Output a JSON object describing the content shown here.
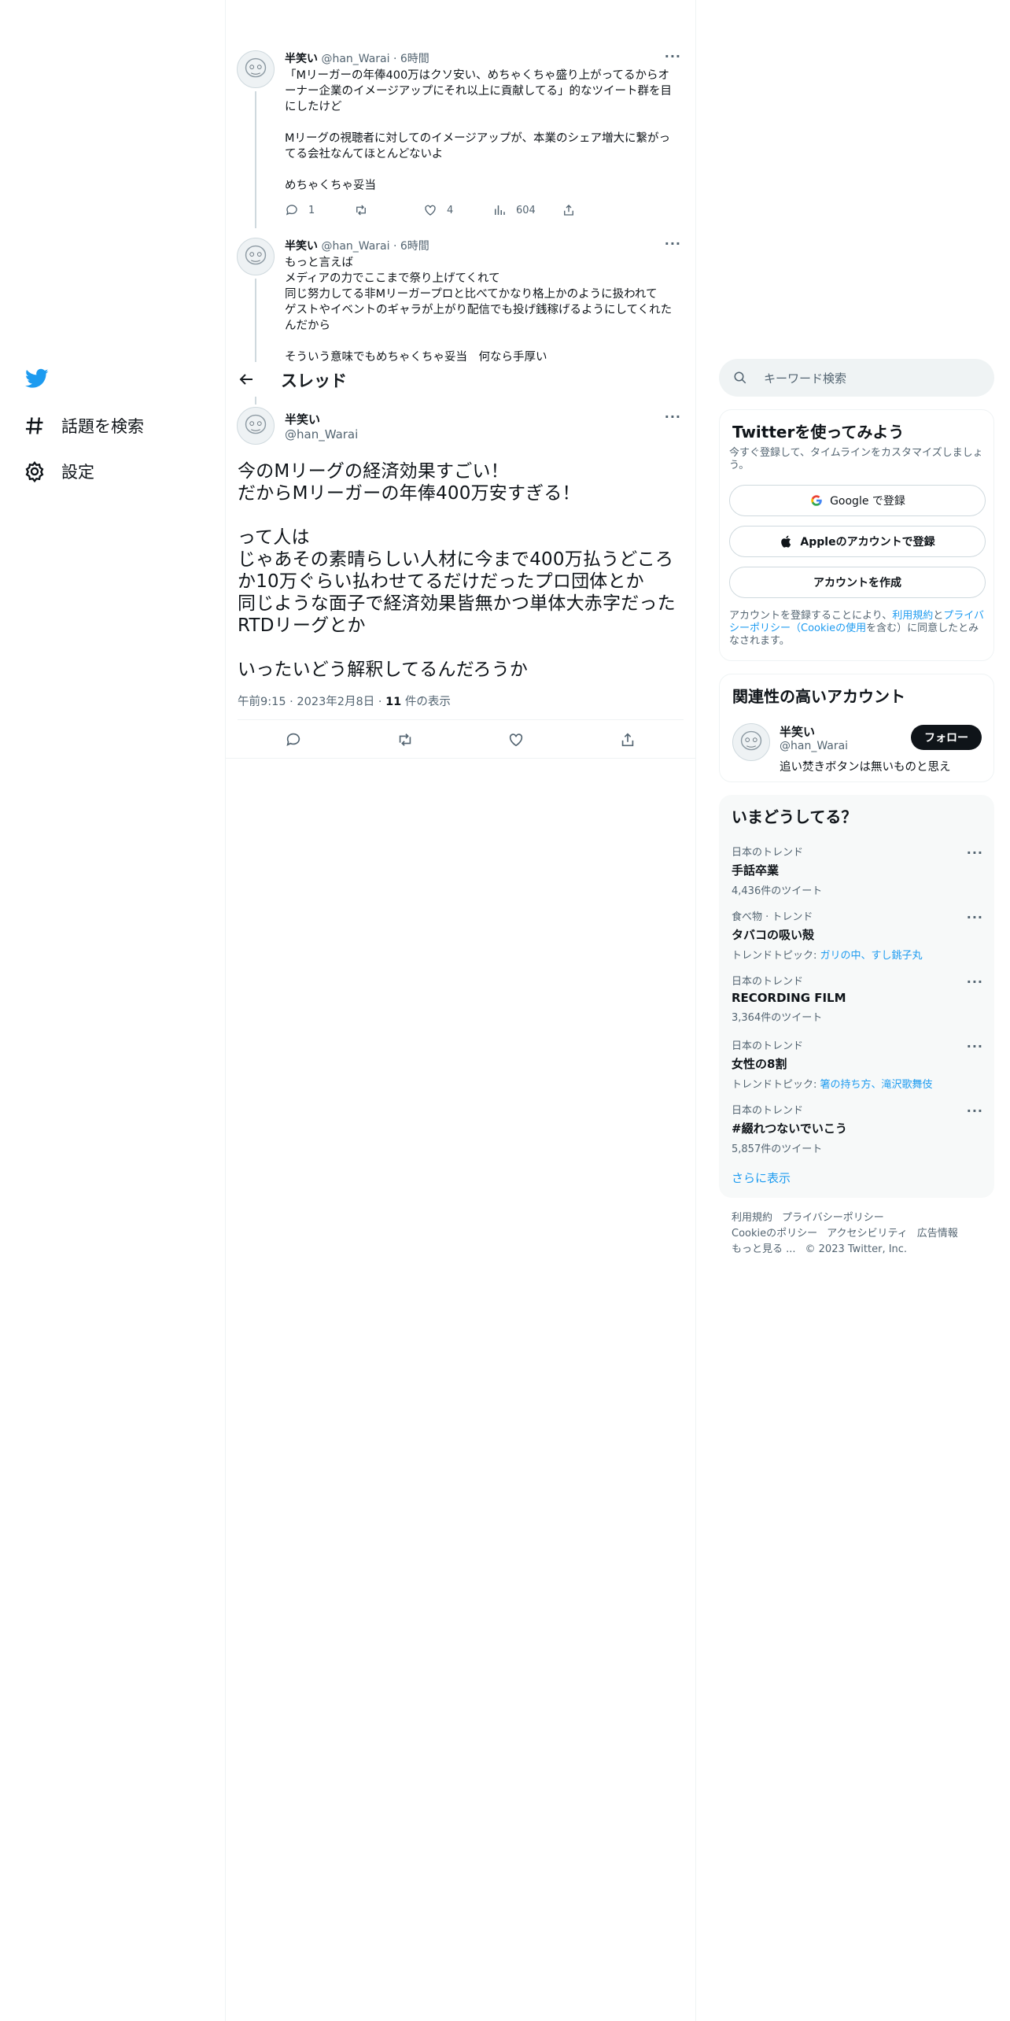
{
  "nav": {
    "explore_label": "話題を検索",
    "settings_label": "設定"
  },
  "thread": {
    "header_title": "スレッド",
    "prev_tweets": [
      {
        "name": "半笑い",
        "handle": "@han_Warai",
        "time": "6時間",
        "text": "「Mリーガーの年俸400万はクソ安い、めちゃくちゃ盛り上がってるからオーナー企業のイメージアップにそれ以上に貢献してる」的なツイート群を目にしたけど\n\nMリーグの視聴者に対してのイメージアップが、本業のシェア増大に繋がってる会社なんてほとんどないよ\n\nめちゃくちゃ妥当",
        "replies": "1",
        "retweets": "",
        "likes": "4",
        "views": "604"
      },
      {
        "name": "半笑い",
        "handle": "@han_Warai",
        "time": "6時間",
        "text": "もっと言えば\nメディアの力でここまで祭り上げてくれて\n同じ努力してる非Mリーガープロと比べてかなり格上かのように扱われて\nゲストやイベントのギャラが上がり配信でも投げ銭稼げるようにしてくれたんだから\n\nそういう意味でもめちゃくちゃ妥当　何なら手厚い"
      }
    ],
    "focal": {
      "name": "半笑い",
      "handle": "@han_Warai",
      "text": "今のMリーグの経済効果すごい！\nだからMリーガーの年俸400万安すぎる！\n\nって人は\nじゃあその素晴らしい人材に今まで400万払うどころか10万ぐらい払わせてるだけだったプロ団体とか\n同じような面子で経済効果皆無かつ単体大赤字だったRTDリーグとか\n\nいったいどう解釈してるんだろうか",
      "time": "午前9:15",
      "date": "2023年2月8日",
      "views_count": "11",
      "views_label": "件の表示"
    }
  },
  "search": {
    "placeholder": "キーワード検索"
  },
  "signup": {
    "title": "Twitterを使ってみよう",
    "desc": "今すぐ登録して、タイムラインをカスタマイズしましょう。",
    "google_label": "Google で登録",
    "apple_label": "Appleのアカウントで登録",
    "create_label": "アカウントを作成",
    "legal_pre": "アカウントを登録することにより、",
    "legal_terms": "利用規約",
    "legal_and": "と",
    "legal_privacy": "プライバシーポリシー",
    "legal_cookie": "（Cookieの使用",
    "legal_post": "を含む）に同意したとみなされます。"
  },
  "related": {
    "title": "関連性の高いアカウント",
    "name": "半笑い",
    "handle": "@han_Warai",
    "bio": "追い焚きボタンは無いものと思え",
    "follow_label": "フォロー"
  },
  "trends": {
    "title": "いまどうしてる？",
    "items": [
      {
        "category": "日本のトレンド",
        "name": "手話卒業",
        "sub_label": "",
        "sub": "4,436件のツイート"
      },
      {
        "category": "食べ物 · トレンド",
        "name": "タバコの吸い殻",
        "sub_label": "トレンドトピック: ",
        "sub": "ガリの中、すし銚子丸"
      },
      {
        "category": "日本のトレンド",
        "name": "RECORDING FILM",
        "sub_label": "",
        "sub": "3,364件のツイート"
      },
      {
        "category": "日本のトレンド",
        "name": "女性の8割",
        "sub_label": "トレンドトピック: ",
        "sub": "箸の持ち方、滝沢歌舞伎"
      },
      {
        "category": "日本のトレンド",
        "name": "#綴れつないでいこう",
        "sub_label": "",
        "sub": "5,857件のツイート"
      }
    ],
    "show_more": "さらに表示"
  },
  "footer": {
    "line1": [
      "利用規約",
      "プライバシーポリシー"
    ],
    "line2": [
      "Cookieのポリシー",
      "アクセシビリティ",
      "広告情報"
    ],
    "more": "もっと見る ...",
    "copyright": "© 2023 Twitter, Inc."
  },
  "colors": {
    "brand": "#1d9bf0",
    "text": "#0f1419",
    "muted": "#536471",
    "border": "#eff3f4"
  }
}
